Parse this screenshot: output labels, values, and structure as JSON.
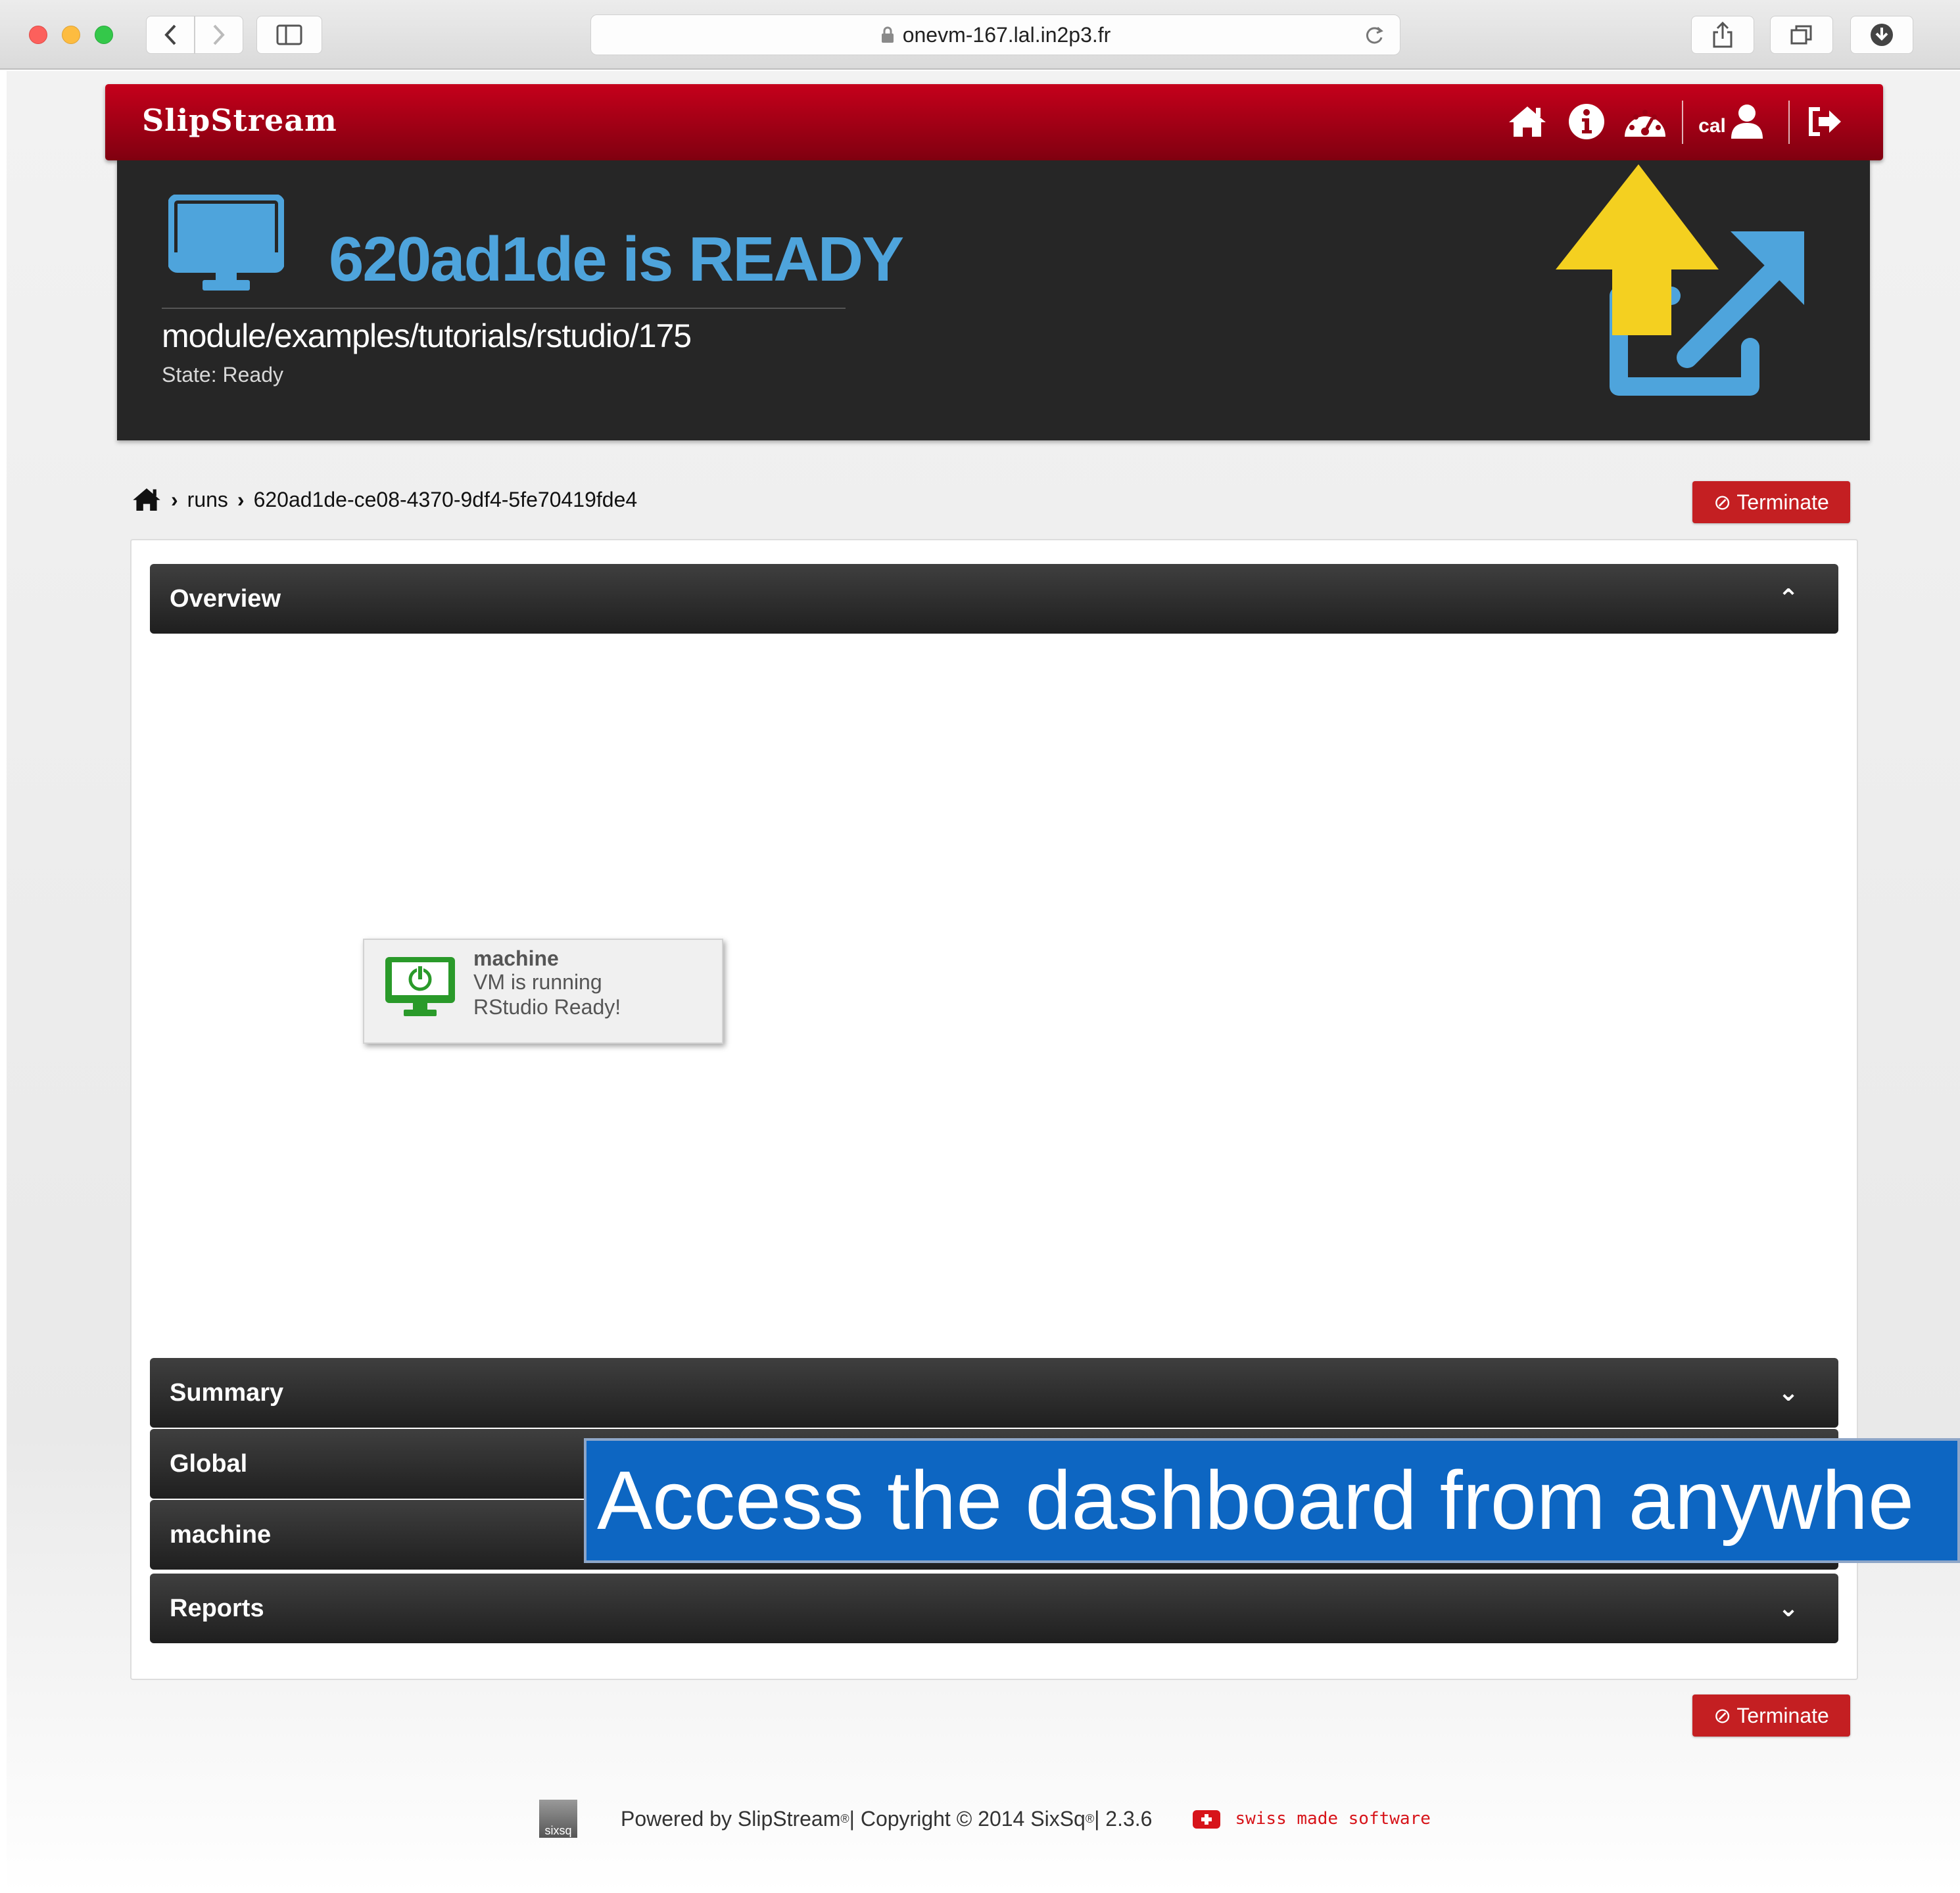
{
  "browser": {
    "url": "onevm-167.lal.in2p3.fr",
    "back_icon": "chevron-left-icon",
    "forward_icon": "chevron-right-icon",
    "sidebar_icon": "sidebar-icon",
    "reload_icon": "reload-icon",
    "share_icon": "share-icon",
    "tabs_icon": "tabs-icon",
    "download_icon": "download-icon"
  },
  "header": {
    "brand": "SlipStream",
    "username": "cal",
    "colors": {
      "bar_top": "#c5001b",
      "bar_bottom": "#800010"
    }
  },
  "hero": {
    "title": "620ad1de is READY",
    "path": "module/examples/tutorials/rstudio/175",
    "state": "State: Ready",
    "accent": "#4ea4dc"
  },
  "breadcrumb": {
    "runs": "runs",
    "run_id": "620ad1de-ce08-4370-9df4-5fe70419fde4"
  },
  "actions": {
    "terminate": "⊘ Terminate",
    "terminate_color": "#c41f22"
  },
  "sections": {
    "overview": "Overview",
    "summary": "Summary",
    "global": "Global",
    "machine": "machine",
    "reports": "Reports"
  },
  "node": {
    "name": "machine",
    "status1": "VM is running",
    "status2": "RStudio Ready!",
    "icon_color": "#2a9a2a"
  },
  "annotation": {
    "caption": "Access the dashboard from anywhe",
    "arrow_color": "#f4d020"
  },
  "footer": {
    "logo": "sixsq",
    "powered": "Powered by SlipStream",
    "copyright": " | Copyright © 2014 SixSq",
    "version": " | 2.3.6",
    "swiss": "swiss made software"
  }
}
